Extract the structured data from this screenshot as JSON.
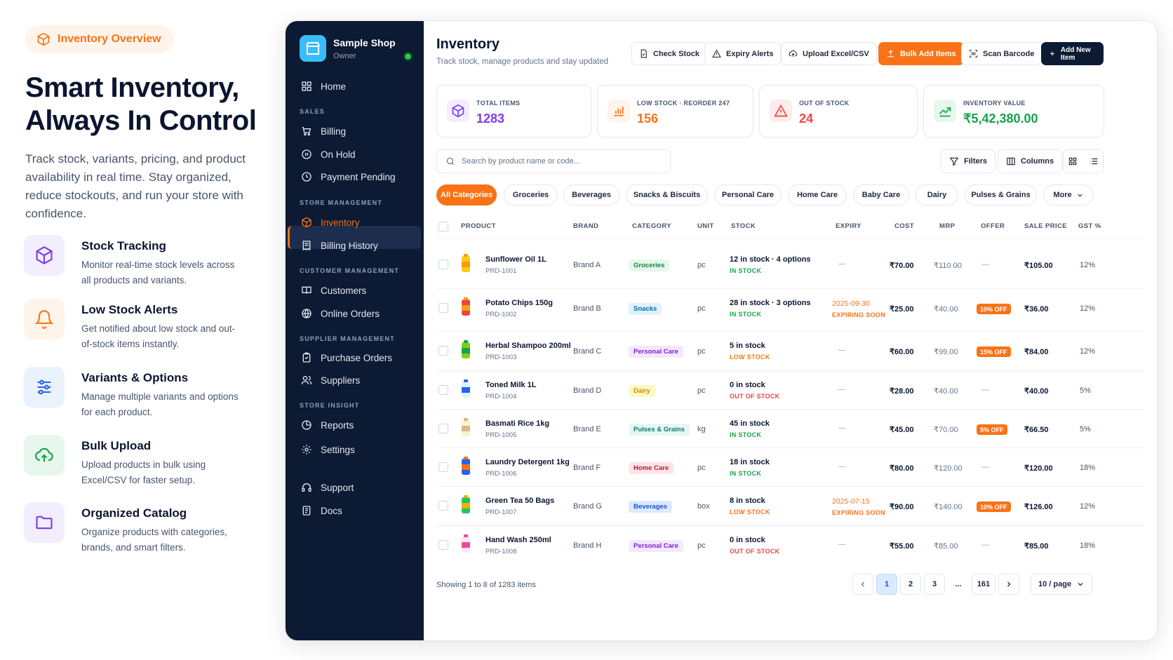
{
  "hero": {
    "pill": "Inventory Overview",
    "title_line1": "Smart Inventory,",
    "title_line2": "Always In Control",
    "subtitle": "Track stock, variants, pricing, and product availability in real time. Stay organized, reduce stockouts, and run your store with confidence."
  },
  "features": [
    {
      "title": "Stock Tracking",
      "desc": "Monitor real-time stock levels across all products and variants.",
      "icon": "cube-icon"
    },
    {
      "title": "Low Stock Alerts",
      "desc": "Get notified about low stock and out-of-stock items instantly.",
      "icon": "bell-icon"
    },
    {
      "title": "Variants & Options",
      "desc": "Manage multiple variants and options for each product.",
      "icon": "sliders-icon"
    },
    {
      "title": "Bulk Upload",
      "desc": "Upload products in bulk using Excel/CSV for faster setup.",
      "icon": "cloud-upload-icon"
    },
    {
      "title": "Organized Catalog",
      "desc": "Organize products with categories, brands, and smart filters.",
      "icon": "folder-icon"
    }
  ],
  "sidebar": {
    "shop_name": "Sample Shop",
    "shop_role": "Owner",
    "home": "Home",
    "sections": {
      "sales": "SALES",
      "store": "STORE MANAGEMENT",
      "customer": "CUSTOMER MANAGEMENT",
      "supplier": "SUPPLIER MANAGEMENT",
      "insight": "STORE INSIGHT"
    },
    "items": {
      "billing": "Billing",
      "on_hold": "On Hold",
      "payment_pending": "Payment Pending",
      "inventory": "Inventory",
      "billing_history": "Billing History",
      "customers": "Customers",
      "online_orders": "Online Orders",
      "purchase_orders": "Purchase Orders",
      "suppliers": "Suppliers",
      "reports": "Reports",
      "settings": "Settings",
      "support": "Support",
      "docs": "Docs"
    }
  },
  "header": {
    "title": "Inventory",
    "subtitle": "Track stock, manage products and stay updated",
    "buttons": {
      "check_stock": "Check Stock",
      "expiry_alerts": "Expiry Alerts",
      "upload": "Upload Excel/CSV",
      "bulk_add": "Bulk Add Items",
      "scan": "Scan Barcode",
      "add_new": "Add New Item"
    }
  },
  "stats": [
    {
      "label": "TOTAL ITEMS",
      "value": "1283",
      "color": "#7c3aed"
    },
    {
      "label": "LOW STOCK · REORDER 247",
      "value": "156",
      "color": "#f97316"
    },
    {
      "label": "OUT OF STOCK",
      "value": "24",
      "color": "#ef4444"
    },
    {
      "label": "INVENTORY VALUE",
      "value": "₹5,42,380.00",
      "color": "#16a34a"
    }
  ],
  "search": {
    "placeholder": "Search by product name or code..."
  },
  "toolbar": {
    "filters": "Filters",
    "columns": "Columns"
  },
  "categories": [
    "All Categories",
    "Groceries",
    "Beverages",
    "Snacks & Biscuits",
    "Personal Care",
    "Home Care",
    "Baby Care",
    "Dairy",
    "Pulses & Grains",
    "More"
  ],
  "table": {
    "headers": [
      "PRODUCT",
      "BRAND",
      "CATEGORY",
      "UNIT",
      "STOCK",
      "EXPIRY",
      "COST",
      "MRP",
      "OFFER",
      "SALE PRICE",
      "GST %"
    ],
    "rows": [
      {
        "name": "Sunflower Oil 1L",
        "code": "PRD-1001",
        "brand": "Brand A",
        "category": "Groceries",
        "unit": "pc",
        "stock": "12 in stock",
        "options": "· 4 options",
        "status": "IN STOCK",
        "expiry": "—",
        "expiry_label": "",
        "cost": "₹70.00",
        "mrp": "₹110.00",
        "offer": "—",
        "sale": "₹105.00",
        "gst": "12%"
      },
      {
        "name": "Potato Chips 150g",
        "code": "PRD-1002",
        "brand": "Brand B",
        "category": "Snacks",
        "unit": "pc",
        "stock": "28 in stock",
        "options": "· 3 options",
        "status": "IN STOCK",
        "expiry": "2025-09-30",
        "expiry_label": "EXPIRING SOON",
        "cost": "₹25.00",
        "mrp": "₹40.00",
        "offer": "10% OFF",
        "sale": "₹36.00",
        "gst": "12%"
      },
      {
        "name": "Herbal Shampoo 200ml",
        "code": "PRD-1003",
        "brand": "Brand C",
        "category": "Personal Care",
        "unit": "pc",
        "stock": "5 in stock",
        "options": "",
        "status": "LOW STOCK",
        "expiry": "—",
        "expiry_label": "",
        "cost": "₹60.00",
        "mrp": "₹99.00",
        "offer": "15% OFF",
        "sale": "₹84.00",
        "gst": "12%"
      },
      {
        "name": "Toned Milk 1L",
        "code": "PRD-1004",
        "brand": "Brand D",
        "category": "Dairy",
        "unit": "pc",
        "stock": "0 in stock",
        "options": "",
        "status": "OUT OF STOCK",
        "expiry": "—",
        "expiry_label": "",
        "cost": "₹28.00",
        "mrp": "₹40.00",
        "offer": "—",
        "sale": "₹40.00",
        "gst": "5%"
      },
      {
        "name": "Basmati Rice 1kg",
        "code": "PRD-1005",
        "brand": "Brand E",
        "category": "Pulses & Grains",
        "unit": "kg",
        "stock": "45 in stock",
        "options": "",
        "status": "IN STOCK",
        "expiry": "—",
        "expiry_label": "",
        "cost": "₹45.00",
        "mrp": "₹70.00",
        "offer": "5% OFF",
        "sale": "₹66.50",
        "gst": "5%"
      },
      {
        "name": "Laundry Detergent 1kg",
        "code": "PRD-1006",
        "brand": "Brand F",
        "category": "Home Care",
        "unit": "pc",
        "stock": "18 in stock",
        "options": "",
        "status": "IN STOCK",
        "expiry": "—",
        "expiry_label": "",
        "cost": "₹80.00",
        "mrp": "₹120.00",
        "offer": "—",
        "sale": "₹120.00",
        "gst": "18%"
      },
      {
        "name": "Green Tea 50 Bags",
        "code": "PRD-1007",
        "brand": "Brand G",
        "category": "Beverages",
        "unit": "box",
        "stock": "8 in stock",
        "options": "",
        "status": "LOW STOCK",
        "expiry": "2025-07-15",
        "expiry_label": "EXPIRING SOON",
        "cost": "₹90.00",
        "mrp": "₹140.00",
        "offer": "10% OFF",
        "sale": "₹126.00",
        "gst": "12%"
      },
      {
        "name": "Hand Wash 250ml",
        "code": "PRD-1008",
        "brand": "Brand H",
        "category": "Personal Care",
        "unit": "pc",
        "stock": "0 in stock",
        "options": "",
        "status": "OUT OF STOCK",
        "expiry": "—",
        "expiry_label": "",
        "cost": "₹55.00",
        "mrp": "₹85.00",
        "offer": "—",
        "sale": "₹85.00",
        "gst": "18%"
      }
    ]
  },
  "pagination": {
    "showing": "Showing 1 to 8 of 1283 items",
    "pages": [
      "1",
      "2",
      "3",
      "...",
      "161"
    ],
    "per_page": "10 / page"
  }
}
